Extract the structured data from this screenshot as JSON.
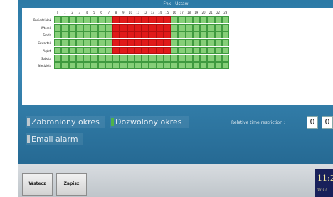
{
  "window": {
    "title": "Fhk - Ustaw"
  },
  "schedule": {
    "hours": [
      "0",
      "1",
      "2",
      "3",
      "4",
      "5",
      "6",
      "7",
      "8",
      "9",
      "10",
      "11",
      "12",
      "13",
      "14",
      "15",
      "16",
      "17",
      "18",
      "19",
      "20",
      "21",
      "22",
      "23"
    ],
    "days": [
      {
        "label": "Poniedziałek",
        "blocked_from": 8,
        "blocked_to": 16
      },
      {
        "label": "Wtorek",
        "blocked_from": 8,
        "blocked_to": 16
      },
      {
        "label": "Środa",
        "blocked_from": 8,
        "blocked_to": 16
      },
      {
        "label": "Czwartek",
        "blocked_from": 8,
        "blocked_to": 16
      },
      {
        "label": "Piątek",
        "blocked_from": 8,
        "blocked_to": 16
      },
      {
        "label": "Sobota",
        "blocked_from": null,
        "blocked_to": null
      },
      {
        "label": "Niedziela",
        "blocked_from": null,
        "blocked_to": null
      }
    ],
    "colors": {
      "allowed": "#86cf78",
      "blocked": "#e01a1a"
    }
  },
  "legend": {
    "forbidden_label": "Zabroniony okres",
    "allowed_label": "Dozwolony okres",
    "email_alarm_label": "Email alarm"
  },
  "restriction": {
    "label": "Relative time restriction :",
    "value1": "0",
    "value2": "0"
  },
  "footer": {
    "back_label": "Wstecz",
    "save_label": "Zapisz"
  },
  "clock": {
    "time": "11:2",
    "date": "2019.0"
  }
}
